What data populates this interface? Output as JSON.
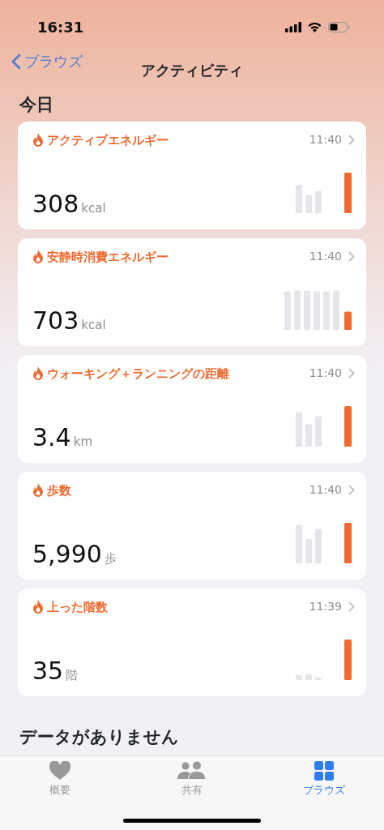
{
  "status_bar": {
    "time": "16:31"
  },
  "nav": {
    "back": "ブラウズ",
    "title": "アクティビティ"
  },
  "section_title": "今日",
  "cards": [
    {
      "title": "アクティブエネルギー",
      "time": "11:40",
      "value": "308",
      "unit": "kcal"
    },
    {
      "title": "安静時消費エネルギー",
      "time": "11:40",
      "value": "703",
      "unit": "kcal"
    },
    {
      "title": "ウォーキング＋ランニングの距離",
      "time": "11:40",
      "value": "3.4",
      "unit": "km"
    },
    {
      "title": "歩数",
      "time": "11:40",
      "value": "5,990",
      "unit": "歩"
    },
    {
      "title": "上った階数",
      "time": "11:39",
      "value": "35",
      "unit": "階"
    }
  ],
  "empty_heading": "データがありません",
  "tab_bar": [
    {
      "label": "概要",
      "kind": "heart",
      "selected": false
    },
    {
      "label": "共有",
      "kind": "people",
      "selected": false
    },
    {
      "label": "ブラウズ",
      "kind": "grid",
      "selected": true
    }
  ]
}
